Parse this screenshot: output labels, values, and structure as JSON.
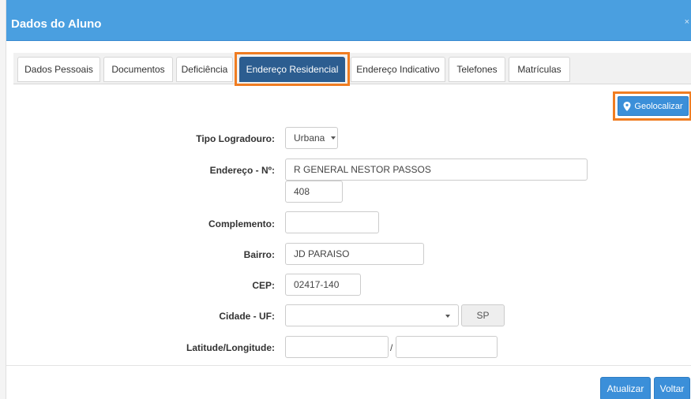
{
  "modal": {
    "title": "Dados do Aluno",
    "close_label": "×"
  },
  "tabs": [
    {
      "label": "Dados Pessoais",
      "active": false
    },
    {
      "label": "Documentos",
      "active": false
    },
    {
      "label": "Deficiência",
      "active": false
    },
    {
      "label": "Endereço Residencial",
      "active": true
    },
    {
      "label": "Endereço Indicativo",
      "active": false
    },
    {
      "label": "Telefones",
      "active": false
    },
    {
      "label": "Matrículas",
      "active": false
    }
  ],
  "geolocalizar": {
    "label": "Geolocalizar",
    "icon": "map-pin-icon"
  },
  "form": {
    "tipo_logradouro": {
      "label": "Tipo Logradouro:",
      "value": "Urbana"
    },
    "endereco": {
      "label": "Endereço - Nº:",
      "value": "R GENERAL NESTOR PASSOS",
      "numero": "408"
    },
    "complemento": {
      "label": "Complemento:",
      "value": ""
    },
    "bairro": {
      "label": "Bairro:",
      "value": "JD PARAISO"
    },
    "cep": {
      "label": "CEP:",
      "value": "02417-140"
    },
    "cidade_uf": {
      "label": "Cidade - UF:",
      "cidade": "",
      "uf": "SP"
    },
    "lat_long": {
      "label": "Latitude/Longitude:",
      "latitude": "",
      "separator": "/",
      "longitude": ""
    }
  },
  "footer": {
    "atualizar_label": "Atualizar",
    "voltar_label": "Voltar"
  },
  "colors": {
    "header": "#4a9fe0",
    "active_tab": "#2c5d90",
    "primary_button": "#3b8fd9",
    "highlight": "#f07d22"
  }
}
